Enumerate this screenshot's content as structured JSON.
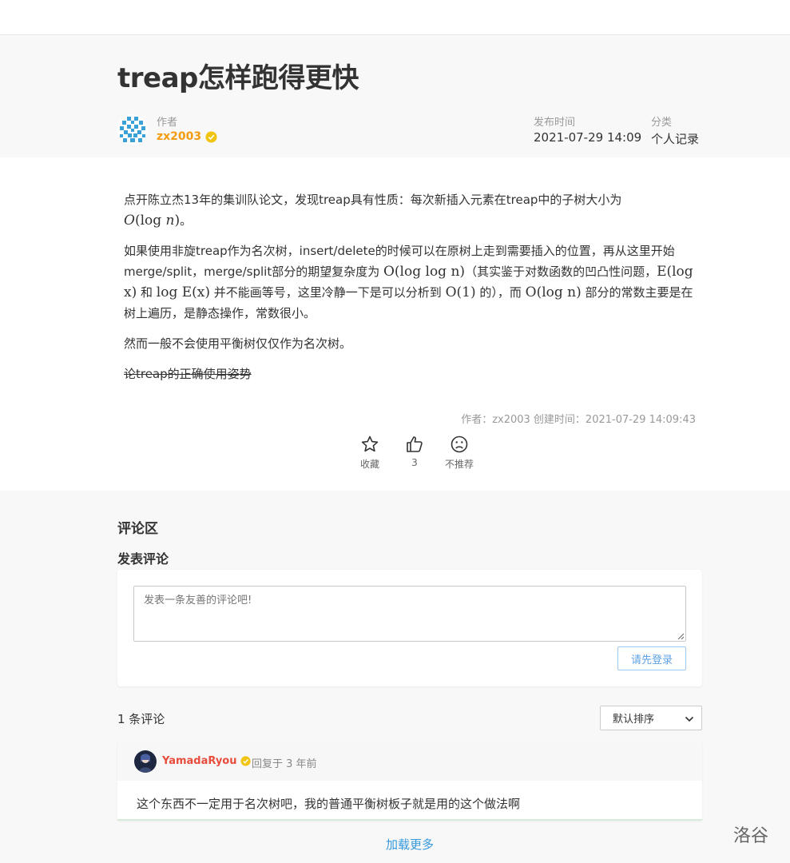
{
  "article": {
    "title": "treap怎样跑得更快",
    "author_label": "作者",
    "author_name": "zx2003",
    "publish_label": "发布时间",
    "publish_time": "2021-07-29 14:09",
    "category_label": "分类",
    "category": "个人记录"
  },
  "content": {
    "p1_text": "点开陈立杰13年的集训队论文，发现treap具有性质：每次新插入元素在treap中的子树大小为",
    "p1_math_O": "O",
    "p1_math_log": "(log ",
    "p1_math_n": "n",
    "p1_math_close": ")",
    "p1_end": "。",
    "p2_a": "如果使用非旋treap作为名次树，insert/delete的时候可以在原树上走到需要插入的位置，再从这里开始merge/split，merge/split部分的期望复杂度为 ",
    "p2_m1": "O(log log n)",
    "p2_b": "（其实鉴于对数函数的凹凸性问题，",
    "p2_m2": "E(log x)",
    "p2_c": " 和 ",
    "p2_m3": "log E(x)",
    "p2_d": " 并不能画等号，这里冷静一下是可以分析到 ",
    "p2_m4": "O(1)",
    "p2_e": " 的），而 ",
    "p2_m5": "O(log n)",
    "p2_f": " 部分的常数主要是在树上遍历，是静态操作，常数很小。",
    "p3": "然而一般不会使用平衡树仅仅作为名次树。",
    "p4": "论treap的正确使用姿势"
  },
  "footer": {
    "meta": "作者：zx2003    创建时间：2021-07-29 14:09:43",
    "favorite_label": "收藏",
    "like_count": "3",
    "dislike_label": "不推荐"
  },
  "comments": {
    "section_title": "评论区",
    "post_title": "发表评论",
    "input_placeholder": "发表一条友善的评论吧!",
    "login_button": "请先登录",
    "count_text": "1 条评论",
    "sort_selected": "默认排序",
    "items": [
      {
        "user": "YamadaRyou",
        "time": "回复于 3 年前",
        "text": "这个东西不一定用于名次树吧，我的普通平衡树板子就是用的这个做法啊"
      }
    ],
    "load_more": "加载更多"
  },
  "watermark": "洛谷",
  "colors": {
    "author": "#f39c11",
    "comment_user": "#e74c3c",
    "link": "#3498db",
    "badge": "#f1c40f"
  }
}
